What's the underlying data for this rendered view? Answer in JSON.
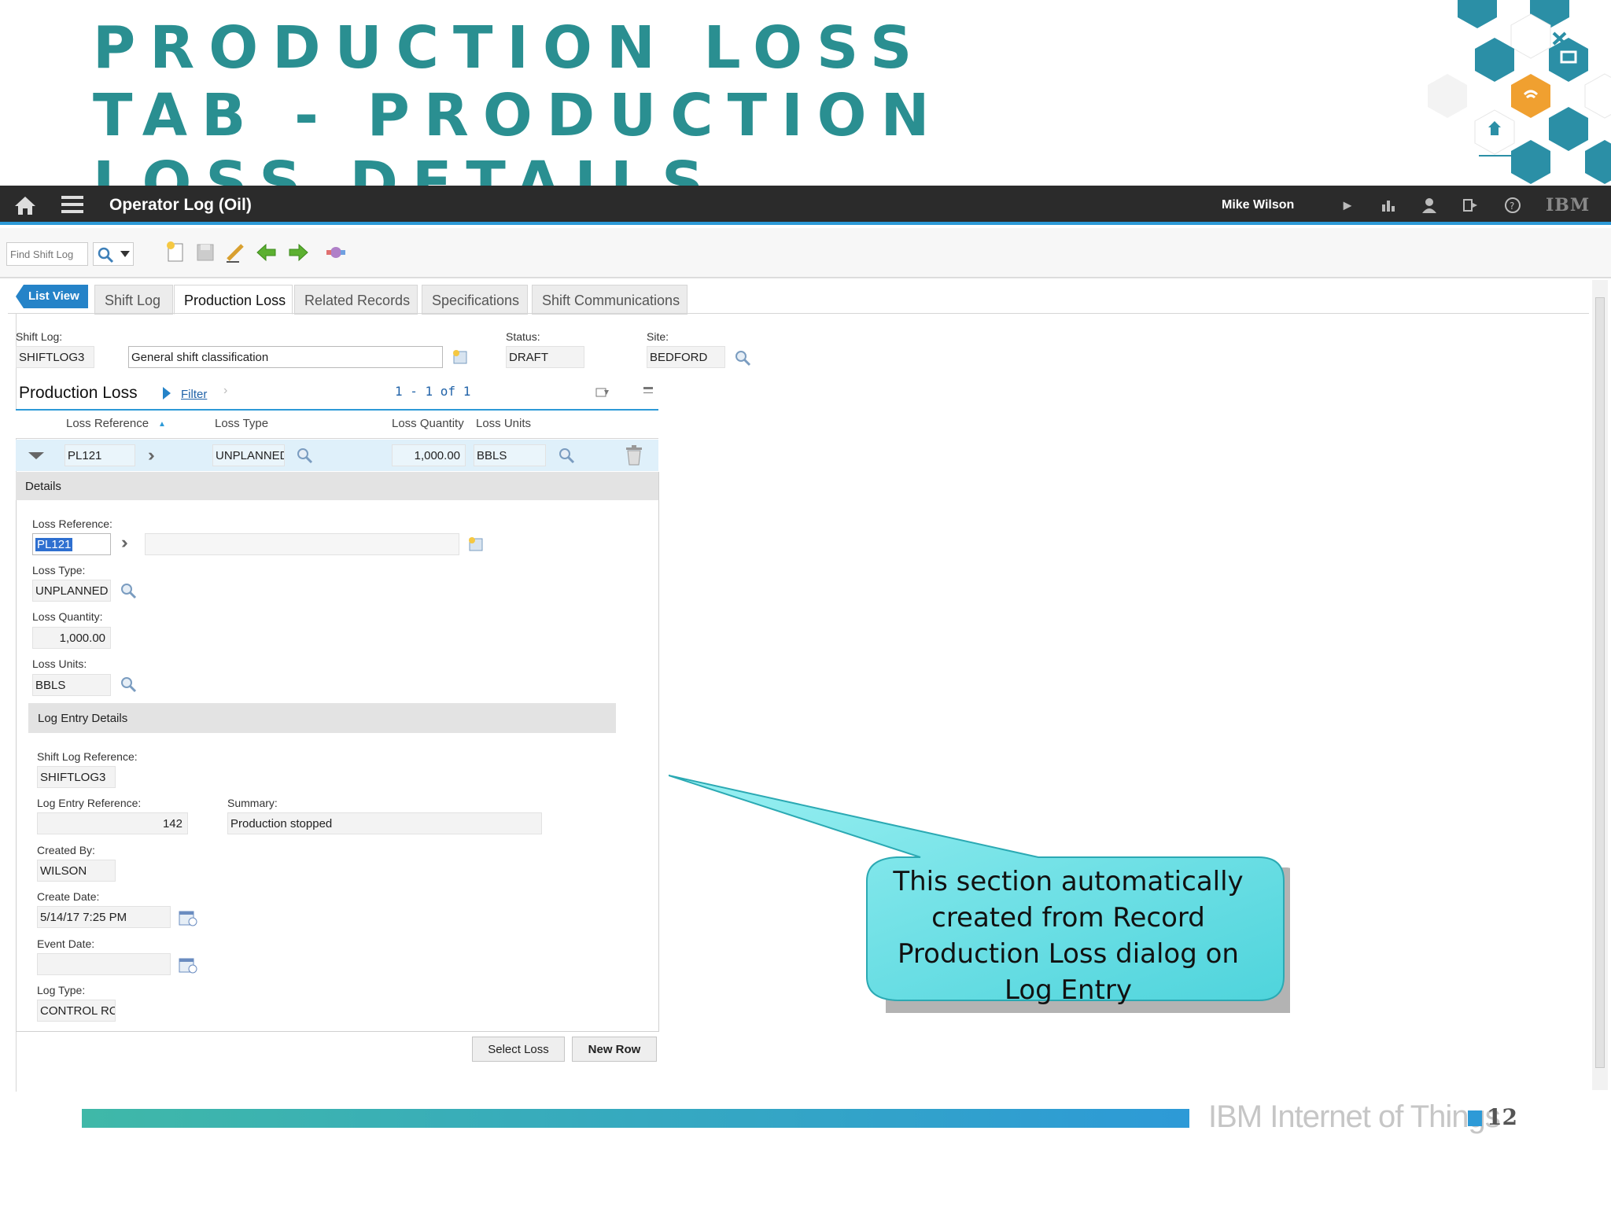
{
  "slide": {
    "title_lines": [
      "Production Loss",
      "Tab - Production",
      "Loss Details"
    ]
  },
  "header": {
    "app_title": "Operator Log (Oil)",
    "user": "Mike Wilson",
    "brand": "IBM"
  },
  "toolbar": {
    "find_placeholder": "Find Shift Log"
  },
  "tabs": {
    "list_view": "List View",
    "items": [
      "Shift Log",
      "Production Loss",
      "Related Records",
      "Specifications",
      "Shift Communications"
    ],
    "active": "Production Loss"
  },
  "record": {
    "shift_log_label": "Shift Log:",
    "shift_log_value": "SHIFTLOG3",
    "description_value": "General shift classification",
    "status_label": "Status:",
    "status_value": "DRAFT",
    "site_label": "Site:",
    "site_value": "BEDFORD"
  },
  "production_loss": {
    "section_title": "Production Loss",
    "filter_label": "Filter",
    "pagination": "1 - 1 of 1",
    "columns": [
      "Loss Reference",
      "Loss Type",
      "Loss Quantity",
      "Loss Units"
    ],
    "rows": [
      {
        "loss_reference": "PL121",
        "loss_type": "UNPLANNED",
        "loss_quantity": "1,000.00",
        "loss_units": "BBLS"
      }
    ]
  },
  "details": {
    "header": "Details",
    "loss_reference_label": "Loss Reference:",
    "loss_reference_value": "PL121",
    "loss_type_label": "Loss Type:",
    "loss_type_value": "UNPLANNED L",
    "loss_quantity_label": "Loss Quantity:",
    "loss_quantity_value": "1,000.00",
    "loss_units_label": "Loss Units:",
    "loss_units_value": "BBLS"
  },
  "log_entry": {
    "header": "Log Entry Details",
    "shift_log_ref_label": "Shift Log Reference:",
    "shift_log_ref_value": "SHIFTLOG3",
    "log_entry_ref_label": "Log Entry Reference:",
    "log_entry_ref_value": "142",
    "summary_label": "Summary:",
    "summary_value": "Production stopped",
    "created_by_label": "Created By:",
    "created_by_value": "WILSON",
    "create_date_label": "Create Date:",
    "create_date_value": "5/14/17 7:25 PM",
    "event_date_label": "Event Date:",
    "event_date_value": "",
    "log_type_label": "Log Type:",
    "log_type_value": "CONTROL RC"
  },
  "buttons": {
    "select_loss": "Select Loss",
    "new_row": "New Row"
  },
  "callout": {
    "lines": [
      "This section automatically",
      "created from Record",
      "Production Loss dialog on",
      "Log Entry"
    ]
  },
  "footer": {
    "brand": "IBM Internet of Things",
    "page_number": "12"
  },
  "colors": {
    "title_teal": "#2a8f91",
    "header_dark": "#2b2b2b",
    "accent_blue": "#2d9ad7",
    "row_highlight": "#dff0fa",
    "callout_fill": "#6fe0e6",
    "hex_teal": "#2b8fa6",
    "hex_orange": "#f0a030"
  }
}
